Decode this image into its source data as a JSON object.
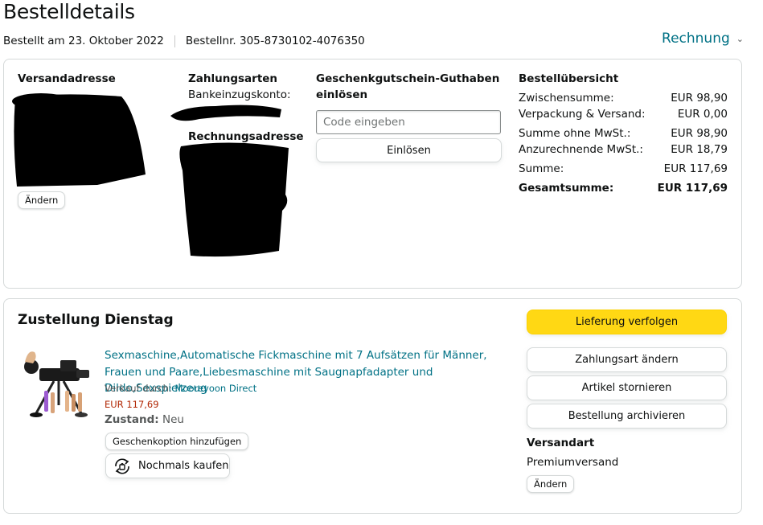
{
  "header": {
    "title": "Bestelldetails",
    "order_date": "Bestellt am 23. Oktober 2022",
    "order_number": "Bestellnr. 305-8730102-4076350",
    "invoice_label": "Rechnung"
  },
  "shipping_address": {
    "heading": "Versandadresse",
    "change_label": "Ändern"
  },
  "payment": {
    "heading": "Zahlungsarten",
    "method_label": "Bankeinzugskonto:",
    "billing_heading": "Rechnungsadresse"
  },
  "gift_card": {
    "heading_line1": "Geschenkgutschein-Guthaben",
    "heading_line2": "einlösen",
    "input_placeholder": "Code eingeben",
    "redeem_label": "Einlösen"
  },
  "order_summary": {
    "heading": "Bestellübersicht",
    "rows": [
      {
        "label": "Zwischensumme:",
        "value": "EUR 98,90"
      },
      {
        "label": "Verpackung & Versand:",
        "value": "EUR 0,00"
      },
      {
        "label": "Summe ohne MwSt.:",
        "value": "EUR 98,90"
      },
      {
        "label": "Anzurechnende MwSt.:",
        "value": "EUR 18,79"
      },
      {
        "label": "Summe:",
        "value": "EUR 117,69"
      },
      {
        "label": "Gesamtsumme:",
        "value": "EUR 117,69"
      }
    ]
  },
  "delivery": {
    "title": "Zustellung Dienstag",
    "product_title": "Sexmaschine,Automatische Fickmaschine mit 7 Aufsätzen für Männer, Frauen und Paare,Liebesmaschine mit Saugnapfadapter und Dildo,Sexspielzeug",
    "sold_by_label": "Verkauf durch:",
    "seller_name": "Mooreyoon Direct",
    "price": "EUR 117,69",
    "condition_label": "Zustand:",
    "condition_value": "Neu",
    "gift_option_label": "Geschenkoption hinzufügen",
    "buy_again_label": "Nochmals kaufen",
    "track_label": "Lieferung verfolgen",
    "change_payment_label": "Zahlungsart ändern",
    "cancel_label": "Artikel stornieren",
    "archive_label": "Bestellung archivieren",
    "shipping_type_heading": "Versandart",
    "shipping_type_value": "Premiumversand",
    "change_label": "Ändern"
  },
  "colors": {
    "link": "#007185",
    "price": "#b12704",
    "primary_button": "#ffd814",
    "border": "#d5d9d9"
  },
  "icons": {
    "invoice_chevron": "chevron-down-icon",
    "buy_again": "buy-again-icon"
  }
}
